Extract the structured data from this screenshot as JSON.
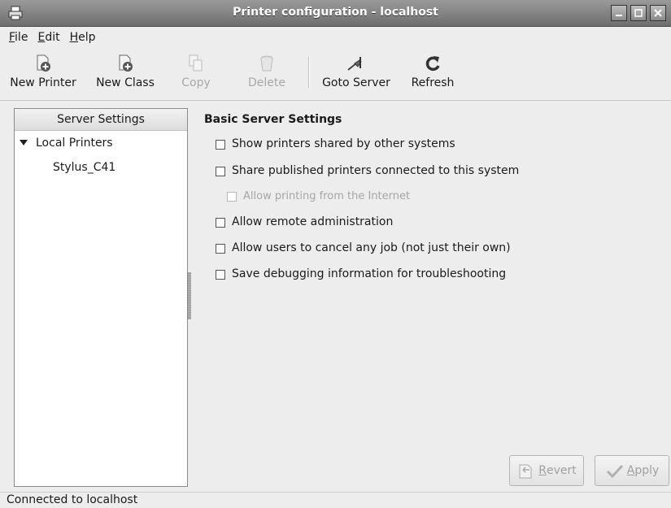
{
  "window": {
    "title": "Printer configuration - localhost",
    "icon": "printer-icon"
  },
  "menu": {
    "file": {
      "first": "F",
      "rest": "ile"
    },
    "edit": {
      "first": "E",
      "rest": "dit"
    },
    "help": {
      "first": "H",
      "rest": "elp"
    }
  },
  "toolbar": {
    "new_printer": "New Printer",
    "new_class": "New Class",
    "copy": "Copy",
    "delete": "Delete",
    "goto_server": "Goto Server",
    "refresh": "Refresh"
  },
  "sidebar": {
    "header": "Server Settings",
    "local_printers": "Local Printers",
    "printer": "Stylus_C41"
  },
  "settings": {
    "title": "Basic Server Settings",
    "options": [
      {
        "label": "Show printers shared by other systems",
        "checked": false
      },
      {
        "label": "Share published printers connected to this system",
        "checked": false
      },
      {
        "label": "Allow printing from the Internet",
        "checked": false,
        "disabled": true
      },
      {
        "label": "Allow remote administration",
        "checked": false
      },
      {
        "label": "Allow users to cancel any job (not just their own)",
        "checked": false
      },
      {
        "label": "Save debugging information for troubleshooting",
        "checked": false
      }
    ]
  },
  "buttons": {
    "revert": {
      "first": "R",
      "rest": "evert"
    },
    "apply": {
      "first": "A",
      "rest": "pply"
    }
  },
  "status": "Connected to localhost"
}
